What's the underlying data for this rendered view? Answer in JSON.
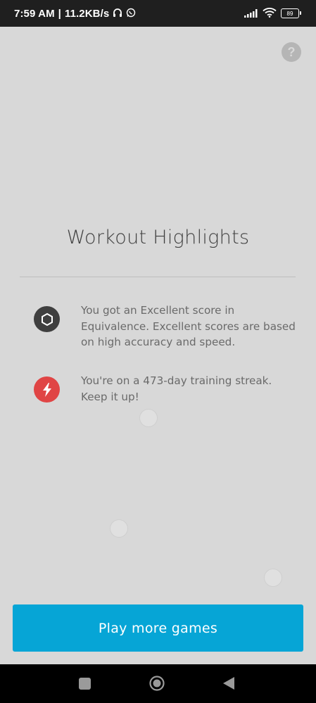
{
  "status_bar": {
    "time": "7:59 AM",
    "separator": "|",
    "network_speed": "11.2KB/s",
    "icons": [
      "headphones-icon",
      "whatsapp-icon",
      "signal-icon",
      "wifi-icon",
      "battery-icon"
    ],
    "battery_level": "89"
  },
  "help": {
    "label": "?"
  },
  "page": {
    "title": "Workout Highlights"
  },
  "highlights": [
    {
      "icon": "hexagon-icon",
      "icon_color": "#3f3f3f",
      "text": "You got an Excellent score in Equivalence. Excellent scores are based on high accuracy and speed."
    },
    {
      "icon": "lightning-bolt-icon",
      "icon_color": "#e04545",
      "text": "You're on a 473-day training streak. Keep it up!"
    }
  ],
  "cta": {
    "label": "Play more games",
    "color": "#06a5d6"
  },
  "nav_bar": {
    "icons": [
      "recents-icon",
      "home-icon",
      "back-icon"
    ]
  },
  "colors": {
    "background": "#d8d8d8",
    "status_bar": "#1f1f1f",
    "nav_bar": "#000000"
  }
}
